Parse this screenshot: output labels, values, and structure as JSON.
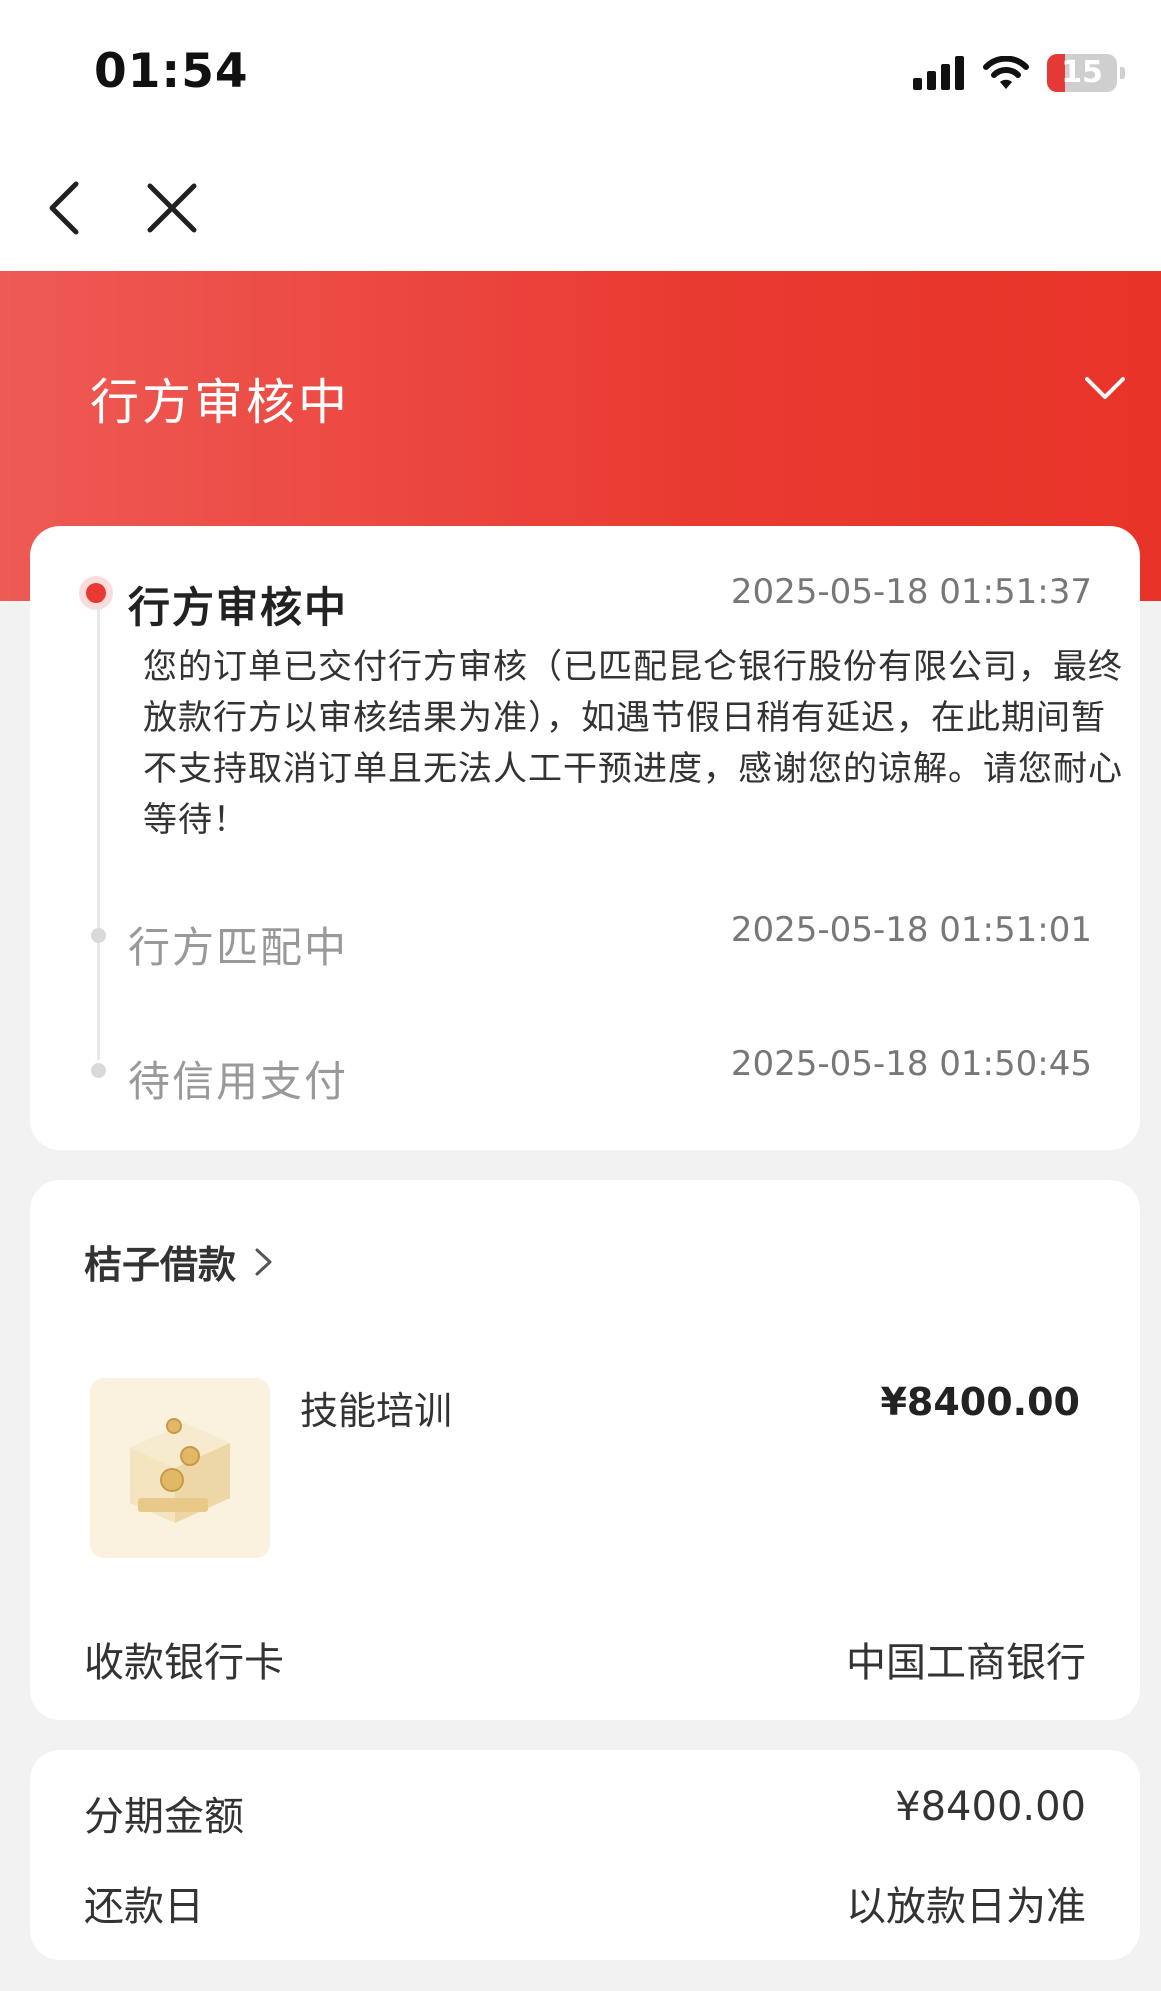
{
  "status_bar": {
    "time": "01:54",
    "battery": "15",
    "battery_color": "#e53935"
  },
  "nav": {
    "back_icon": "chevron-left-icon",
    "close_icon": "close-icon"
  },
  "banner": {
    "title": "行方审核中",
    "accent_color": "#e83a33"
  },
  "progress": {
    "steps": [
      {
        "title": "行方审核中",
        "time": "2025-05-18 01:51:37",
        "active": true,
        "description": "您的订单已交付行方审核（已匹配昆仑银行股份有限公司，最终放款行方以审核结果为准），如遇节假日稍有延迟，在此期间暂不支持取消订单且无法人工干预进度，感谢您的谅解。请您耐心等待！"
      },
      {
        "title": "行方匹配中",
        "time": "2025-05-18 01:51:01",
        "active": false
      },
      {
        "title": "待信用支付",
        "time": "2025-05-18 01:50:45",
        "active": false
      }
    ]
  },
  "order": {
    "merchant": "桔子借款",
    "product_name": "技能培训",
    "product_price": "¥8400.00",
    "bank_card_label": "收款银行卡",
    "bank_card_value": "中国工商银行"
  },
  "installment": {
    "amount_label": "分期金额",
    "amount_value": "¥8400.00",
    "repay_label": "还款日",
    "repay_value": "以放款日为准"
  }
}
